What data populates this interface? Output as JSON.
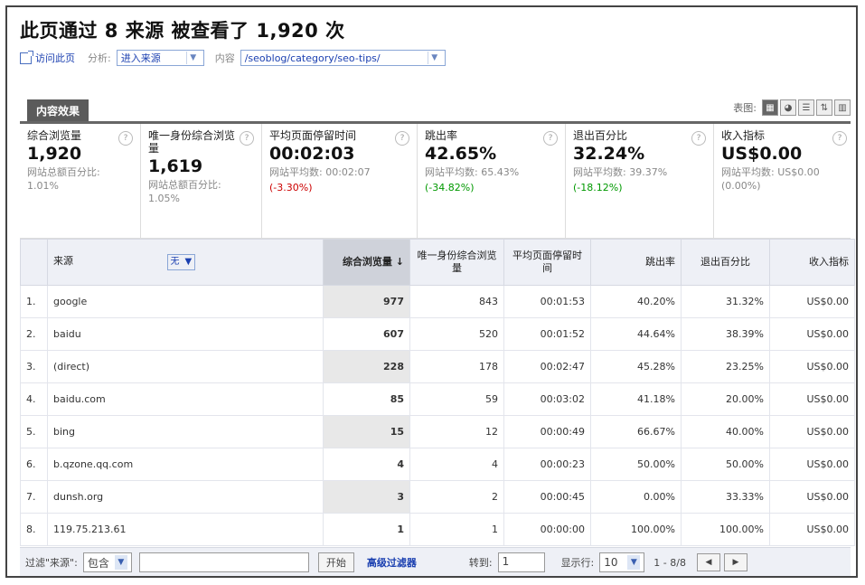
{
  "title": "此页通过 8 来源 被查看了 1,920 次",
  "subbar": {
    "visit_link": "访问此页",
    "analyze_label": "分析:",
    "analyze_value": "进入来源",
    "content_label": "内容",
    "content_value": "/seoblog/category/seo-tips/"
  },
  "tab_label": "内容效果",
  "views_label": "表图:",
  "metrics": [
    {
      "label": "综合浏览量",
      "value": "1,920",
      "sub": "网站总额百分比: 1.01%",
      "delta": ""
    },
    {
      "label": "唯一身份综合浏览量",
      "value": "1,619",
      "sub": "网站总额百分比: 1.05%",
      "delta": ""
    },
    {
      "label": "平均页面停留时间",
      "value": "00:02:03",
      "sub": "网站平均数: 00:02:07",
      "delta": "(-3.30%)"
    },
    {
      "label": "跳出率",
      "value": "42.65%",
      "sub": "网站平均数: 65.43%",
      "delta": "(-34.82%)"
    },
    {
      "label": "退出百分比",
      "value": "32.24%",
      "sub": "网站平均数: 39.37%",
      "delta": "(-18.12%)"
    },
    {
      "label": "收入指标",
      "value": "US$0.00",
      "sub": "网站平均数: US$0.00 (0.00%)",
      "delta": ""
    }
  ],
  "table": {
    "headers": {
      "source": "来源",
      "filter": "无",
      "pageviews": "综合浏览量",
      "unique": "唯一身份综合浏览量",
      "avg_time": "平均页面停留时间",
      "bounce": "跳出率",
      "exit": "退出百分比",
      "revenue": "收入指标"
    },
    "rows": [
      {
        "n": "1.",
        "source": "google",
        "pv": "977",
        "upv": "843",
        "time": "00:01:53",
        "bounce": "40.20%",
        "exit": "31.32%",
        "rev": "US$0.00"
      },
      {
        "n": "2.",
        "source": "baidu",
        "pv": "607",
        "upv": "520",
        "time": "00:01:52",
        "bounce": "44.64%",
        "exit": "38.39%",
        "rev": "US$0.00"
      },
      {
        "n": "3.",
        "source": "(direct)",
        "pv": "228",
        "upv": "178",
        "time": "00:02:47",
        "bounce": "45.28%",
        "exit": "23.25%",
        "rev": "US$0.00"
      },
      {
        "n": "4.",
        "source": "baidu.com",
        "pv": "85",
        "upv": "59",
        "time": "00:03:02",
        "bounce": "41.18%",
        "exit": "20.00%",
        "rev": "US$0.00"
      },
      {
        "n": "5.",
        "source": "bing",
        "pv": "15",
        "upv": "12",
        "time": "00:00:49",
        "bounce": "66.67%",
        "exit": "40.00%",
        "rev": "US$0.00"
      },
      {
        "n": "6.",
        "source": "b.qzone.qq.com",
        "pv": "4",
        "upv": "4",
        "time": "00:00:23",
        "bounce": "50.00%",
        "exit": "50.00%",
        "rev": "US$0.00"
      },
      {
        "n": "7.",
        "source": "dunsh.org",
        "pv": "3",
        "upv": "2",
        "time": "00:00:45",
        "bounce": "0.00%",
        "exit": "33.33%",
        "rev": "US$0.00"
      },
      {
        "n": "8.",
        "source": "119.75.213.61",
        "pv": "1",
        "upv": "1",
        "time": "00:00:00",
        "bounce": "100.00%",
        "exit": "100.00%",
        "rev": "US$0.00"
      }
    ]
  },
  "footer": {
    "filter_label": "过滤\"来源\":",
    "filter_mode": "包含",
    "go_button": "开始",
    "advanced_link": "高级过滤器",
    "goto_label": "转到:",
    "goto_value": "1",
    "rows_label": "显示行:",
    "rows_value": "10",
    "range": "1 - 8/8"
  },
  "colors": {
    "accent": "#1a3fb0",
    "negative": "#cc0000",
    "positive": "#009900",
    "tab": "#5b5b5b"
  }
}
